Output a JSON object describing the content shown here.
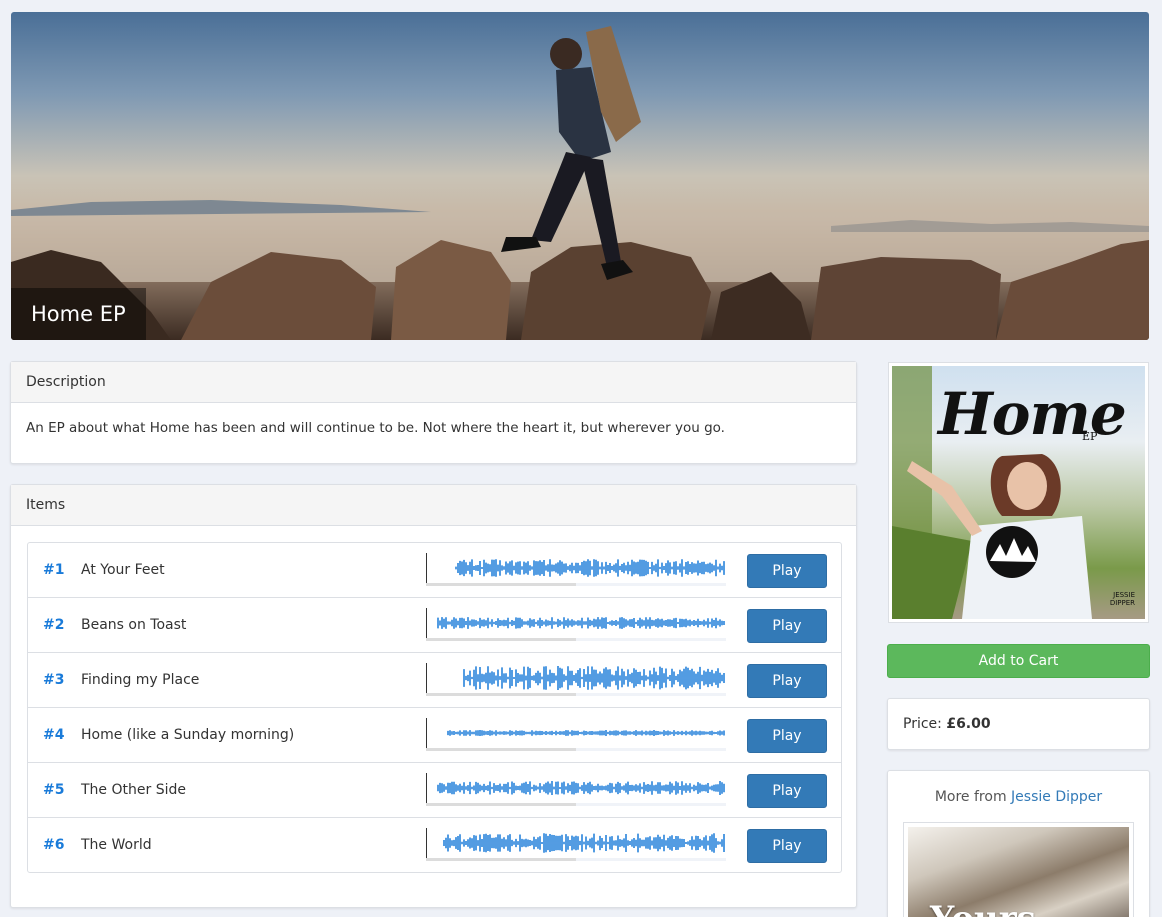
{
  "album": {
    "title": "Home EP",
    "cover_title": "Home",
    "cover_subtitle": "EP",
    "cover_artist_line1": "JESSIE",
    "cover_artist_line2": "DIPPER"
  },
  "description": {
    "heading": "Description",
    "text": "An EP about what Home has been and will continue to be. Not where the heart it, but wherever you go."
  },
  "items": {
    "heading": "Items",
    "play_label": "Play",
    "tracks": [
      {
        "number": "#1",
        "title": "At Your Feet",
        "progress": 0.5
      },
      {
        "number": "#2",
        "title": "Beans on Toast",
        "progress": 0.5
      },
      {
        "number": "#3",
        "title": "Finding my Place",
        "progress": 0.5
      },
      {
        "number": "#4",
        "title": "Home (like a Sunday morning)",
        "progress": 0.5
      },
      {
        "number": "#5",
        "title": "The Other Side",
        "progress": 0.5
      },
      {
        "number": "#6",
        "title": "The World",
        "progress": 0.5
      }
    ]
  },
  "sidebar": {
    "add_to_cart_label": "Add to Cart",
    "price_label": "Price:",
    "price_value": "£6.00",
    "more_from_prefix": "More from",
    "more_from_artist": "Jessie Dipper",
    "more_thumb_text": "Yours"
  },
  "colors": {
    "accent": "#1a7bd9",
    "button_primary": "#337ab7",
    "button_success": "#5cb85c",
    "waveform": "#1a7bd9"
  }
}
